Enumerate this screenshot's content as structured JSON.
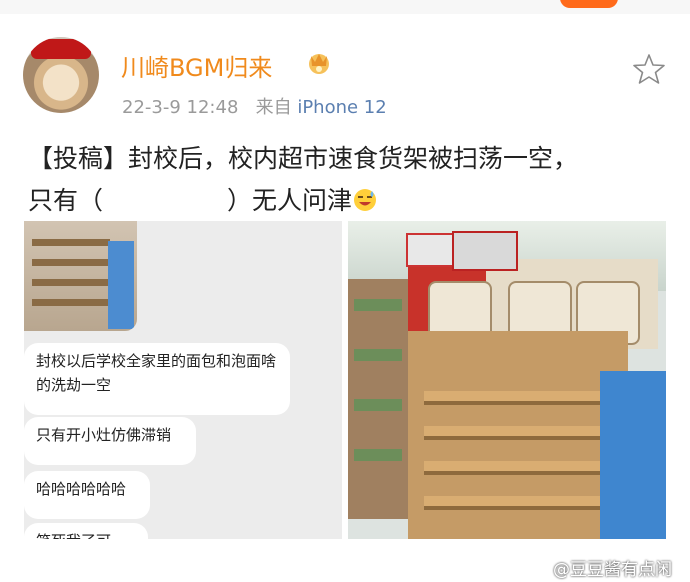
{
  "post": {
    "username": "川崎BGM归来",
    "date": "22-3-9 12:48",
    "source_prefix": "来自",
    "source": "iPhone 12",
    "text_line1": "【投稿】封校后，校内超市速食货架被扫荡一空，",
    "text_line2a": "只有（",
    "text_line2b": "）无人问津",
    "icons": [
      "crown-icon",
      "star-icon",
      "sweat-laugh-emoji",
      "weibo-icon"
    ]
  },
  "left_image": {
    "messages": [
      "封校以后学校全家里的面包和泡面啥的洗劫一空",
      "只有开小灶仿佛滞销",
      "哈哈哈哈哈哈",
      "笑死我了可"
    ]
  },
  "watermark": "@豆豆酱有点闲",
  "colors": {
    "username": "#f08a1c",
    "meta": "#9a9a9a",
    "source": "#5b7fb0"
  }
}
